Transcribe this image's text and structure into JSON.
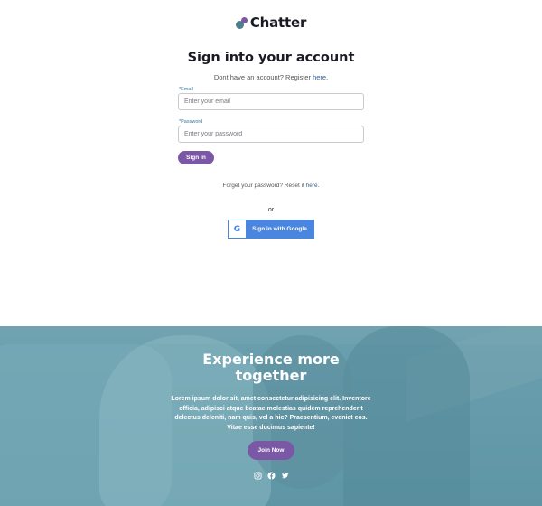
{
  "brand": {
    "name": "Chatter"
  },
  "auth": {
    "title": "Sign into your account",
    "register_prefix": "Dont have an account? Register ",
    "register_link": "here.",
    "email_label": "*Email",
    "email_placeholder": "Enter your email",
    "password_label": "*Password",
    "password_placeholder": "Enter your password",
    "signin_label": "Sign in",
    "forgot_prefix": "Forget your password? Reset it ",
    "forgot_link": "here.",
    "or_text": "or",
    "google_letter": "G",
    "google_label": "Sign in with Google"
  },
  "hero": {
    "title_line1": "Experience more",
    "title_line2": "together",
    "body": "Lorem ipsum dolor sit, amet consectetur adipisicing elit. Inventore officia, adipisci atque beatae molestias quidem reprehenderit delectus deleniti, nam quis, vel a hic? Praesentium, eveniet eos. Vitae esse ducimus sapiente!",
    "join_label": "Join Now",
    "socials": [
      "instagram-icon",
      "facebook-icon",
      "twitter-icon"
    ]
  },
  "colors": {
    "accent": "#7b58a6",
    "link": "#34618c",
    "google_blue": "#4a86e0",
    "hero_bg": "#6a9fae"
  }
}
